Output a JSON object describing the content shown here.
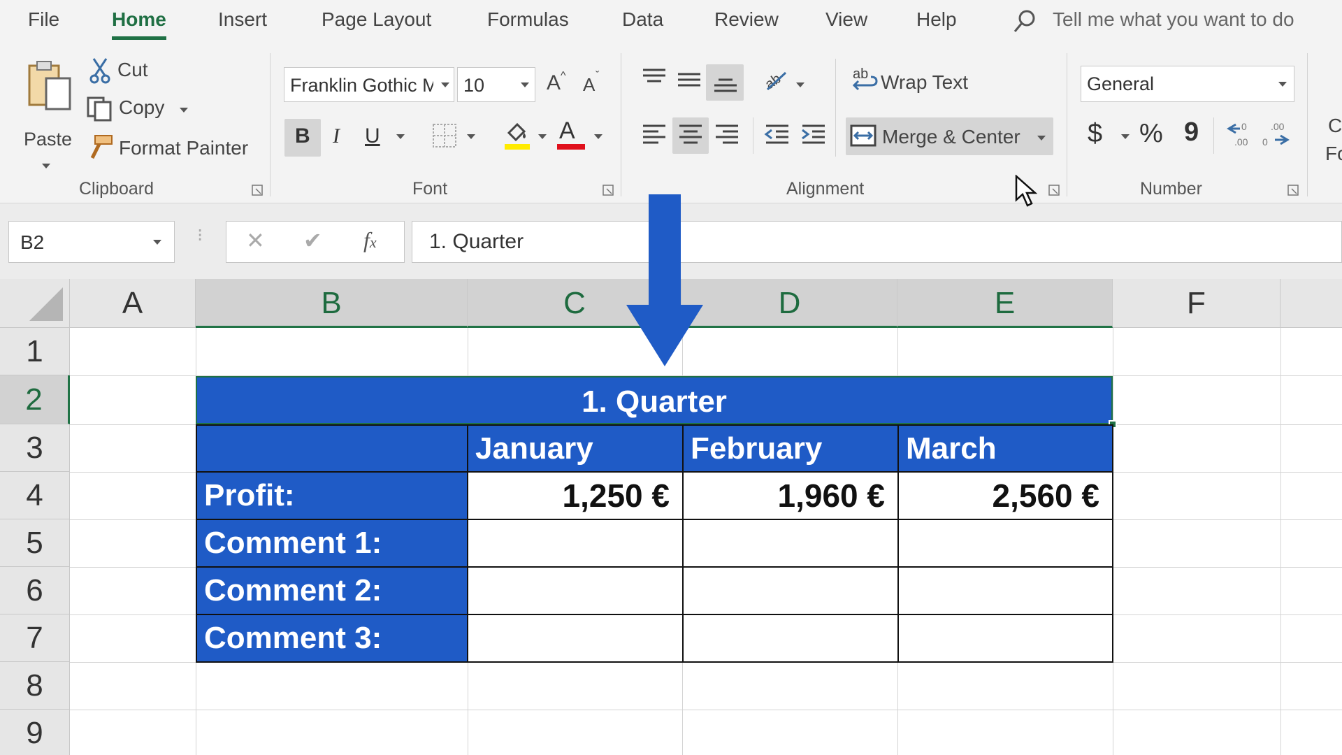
{
  "menu": {
    "tabs": [
      "File",
      "Home",
      "Insert",
      "Page Layout",
      "Formulas",
      "Data",
      "Review",
      "View",
      "Help"
    ],
    "active_tab": "Home",
    "tell_me": "Tell me what you want to do"
  },
  "ribbon": {
    "clipboard": {
      "paste": "Paste",
      "cut": "Cut",
      "copy": "Copy",
      "format_painter": "Format Painter",
      "group_label": "Clipboard"
    },
    "font": {
      "font_name": "Franklin Gothic M",
      "font_size": "10",
      "bold": "B",
      "italic": "I",
      "underline": "U",
      "font_color_letter": "A",
      "grow": "A",
      "shrink": "A",
      "group_label": "Font",
      "highlight_color": "#ffeb00",
      "font_color": "#e0101c"
    },
    "alignment": {
      "wrap_text": "Wrap Text",
      "merge_center": "Merge & Center",
      "group_label": "Alignment"
    },
    "number": {
      "format": "General",
      "currency": "$",
      "percent": "%",
      "comma": "9",
      "group_label": "Number",
      "cut_off_1": "C",
      "cut_off_2": "Fo"
    }
  },
  "formula_bar": {
    "name_box": "B2",
    "formula": "1. Quarter"
  },
  "grid": {
    "columns": [
      "A",
      "B",
      "C",
      "D",
      "E",
      "F"
    ],
    "rows": [
      "1",
      "2",
      "3",
      "4",
      "5",
      "6",
      "7",
      "8",
      "9"
    ],
    "selected_column_headers": [
      "B",
      "C",
      "D",
      "E"
    ],
    "selected_row": "2"
  },
  "table": {
    "title": "1. Quarter",
    "months": [
      "January",
      "February",
      "March"
    ],
    "row_labels": [
      "Profit:",
      "Comment 1:",
      "Comment 2:",
      "Comment 3:"
    ],
    "profit": [
      "1,250 €",
      "1,960 €",
      "2,560 €"
    ],
    "header_color": "#1f5bc6"
  },
  "overlay": {
    "arrow_color": "#1f5bc6"
  }
}
